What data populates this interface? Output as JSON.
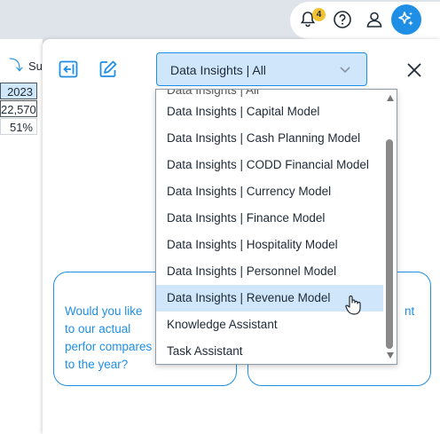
{
  "topbar": {
    "notification_count": "4",
    "icons": [
      "bell-icon",
      "help-icon",
      "user-icon",
      "ai-sparkle-icon"
    ],
    "accent": "#1f8fe6"
  },
  "sheet": {
    "toolbar_text": "Su",
    "cells": [
      "2023",
      "22,570",
      "51%"
    ]
  },
  "panel": {
    "selected_assistant": "Data Insights | All",
    "cards": [
      {
        "text": "Would you like to our actual perfor compares to the year?"
      },
      {
        "text": "nt"
      }
    ]
  },
  "dropdown": {
    "partial_top_item": "Data Insights | All",
    "options": [
      "Data Insights | Capital Model",
      "Data Insights | Cash Planning Model",
      "Data Insights | CODD Financial Model",
      "Data Insights | Currency Model",
      "Data Insights | Finance Model",
      "Data Insights | Hospitality Model",
      "Data Insights | Personnel Model",
      "Data Insights | Revenue Model",
      "Knowledge Assistant",
      "Task Assistant"
    ],
    "highlighted": "Data Insights | Revenue Model"
  }
}
